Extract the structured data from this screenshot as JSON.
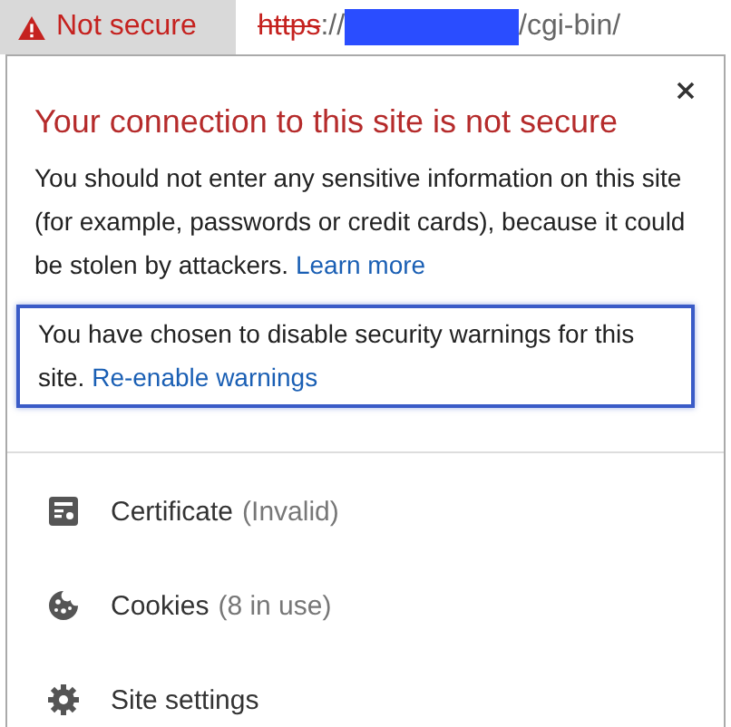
{
  "address_bar": {
    "security_chip": {
      "label": "Not secure"
    },
    "url": {
      "scheme": "https",
      "separator": "://",
      "path": "/cgi-bin/"
    }
  },
  "popup": {
    "title": "Your connection to this site is not secure",
    "message": "You should not enter any sensitive information on this site (for example, passwords or credit cards), because it could be stolen by attackers.",
    "learn_more": "Learn more",
    "notice": {
      "text": "You have chosen to disable security warnings for this site.",
      "link": "Re-enable warnings",
      "highlighted": true
    },
    "items": [
      {
        "kind": "certificate",
        "label": "Certificate",
        "detail": "(Invalid)"
      },
      {
        "kind": "cookies",
        "label": "Cookies",
        "detail": "(8 in use)"
      },
      {
        "kind": "settings",
        "label": "Site settings"
      }
    ]
  }
}
